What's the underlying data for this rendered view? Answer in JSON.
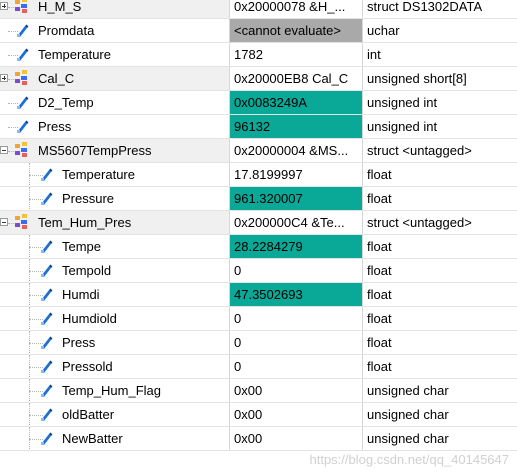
{
  "rows": [
    {
      "name": "H_M_S",
      "value": "0x20000078 &H_...",
      "type": "struct DS1302DATA",
      "level": 0,
      "kind": "struct",
      "expander": "plus",
      "highlight": ""
    },
    {
      "name": "Promdata",
      "value": "<cannot evaluate>",
      "type": "uchar",
      "level": 0,
      "kind": "var",
      "expander": "",
      "highlight": "cannot"
    },
    {
      "name": "Temperature",
      "value": "1782",
      "type": "int",
      "level": 0,
      "kind": "var",
      "expander": "",
      "highlight": ""
    },
    {
      "name": "Cal_C",
      "value": "0x20000EB8 Cal_C",
      "type": "unsigned short[8]",
      "level": 0,
      "kind": "struct",
      "expander": "plus",
      "highlight": ""
    },
    {
      "name": "D2_Temp",
      "value": "0x0083249A",
      "type": "unsigned int",
      "level": 0,
      "kind": "var",
      "expander": "",
      "highlight": "changed"
    },
    {
      "name": "Press",
      "value": "96132",
      "type": "unsigned int",
      "level": 0,
      "kind": "var",
      "expander": "",
      "highlight": "changed"
    },
    {
      "name": "MS5607TempPress",
      "value": "0x20000004 &MS...",
      "type": "struct <untagged>",
      "level": 0,
      "kind": "struct",
      "expander": "minus",
      "highlight": ""
    },
    {
      "name": "Temperature",
      "value": "17.8199997",
      "type": "float",
      "level": 1,
      "kind": "var",
      "expander": "",
      "highlight": ""
    },
    {
      "name": "Pressure",
      "value": "961.320007",
      "type": "float",
      "level": 1,
      "kind": "var",
      "expander": "",
      "highlight": "changed"
    },
    {
      "name": "Tem_Hum_Pres",
      "value": "0x200000C4 &Te...",
      "type": "struct <untagged>",
      "level": 0,
      "kind": "struct",
      "expander": "minus",
      "highlight": ""
    },
    {
      "name": "Tempe",
      "value": "28.2284279",
      "type": "float",
      "level": 1,
      "kind": "var",
      "expander": "",
      "highlight": "changed"
    },
    {
      "name": "Tempold",
      "value": "0",
      "type": "float",
      "level": 1,
      "kind": "var",
      "expander": "",
      "highlight": ""
    },
    {
      "name": "Humdi",
      "value": "47.3502693",
      "type": "float",
      "level": 1,
      "kind": "var",
      "expander": "",
      "highlight": "changed"
    },
    {
      "name": "Humdiold",
      "value": "0",
      "type": "float",
      "level": 1,
      "kind": "var",
      "expander": "",
      "highlight": ""
    },
    {
      "name": "Press",
      "value": "0",
      "type": "float",
      "level": 1,
      "kind": "var",
      "expander": "",
      "highlight": ""
    },
    {
      "name": "Pressold",
      "value": "0",
      "type": "float",
      "level": 1,
      "kind": "var",
      "expander": "",
      "highlight": ""
    },
    {
      "name": "Temp_Hum_Flag",
      "value": "0x00",
      "type": "unsigned char",
      "level": 1,
      "kind": "var",
      "expander": "",
      "highlight": ""
    },
    {
      "name": "oldBatter",
      "value": "0x00",
      "type": "unsigned char",
      "level": 1,
      "kind": "var",
      "expander": "",
      "highlight": ""
    },
    {
      "name": "NewBatter",
      "value": "0x00",
      "type": "unsigned char",
      "level": 1,
      "kind": "var",
      "expander": "",
      "highlight": ""
    }
  ],
  "watermark": "https://blog.csdn.net/qq_40145647",
  "colors": {
    "changed": "#0aa896",
    "cannot": "#a9a9a9",
    "struct_row": "#f0f0f0"
  },
  "icons": {
    "struct": "struct-icon",
    "var": "variable-icon"
  }
}
